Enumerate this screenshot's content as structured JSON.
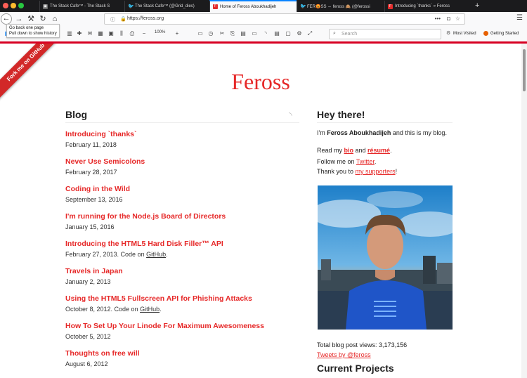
{
  "browser": {
    "tabs": [
      {
        "title": "The Stack Cafe™ - The Stack S",
        "icon": "stack-cafe-favicon"
      },
      {
        "title": "The Stack Cafe™ (@Grid_dies)",
        "icon": "twitter-icon"
      },
      {
        "title": "Home of Feross Aboukhadijeh",
        "icon": "feross-favicon",
        "active": true
      },
      {
        "title": "FER😡SS ⇔ feross 🙈 (@ferossi",
        "icon": "twitter-icon"
      },
      {
        "title": "Introducing `thanks` » Feross",
        "icon": "feross-favicon"
      }
    ],
    "new_tab_label": "+",
    "url": "https://feross.org",
    "tooltip_line1": "Go back one page",
    "tooltip_line2": "Pull down to show history",
    "zoom": "100%",
    "search_placeholder": "Search",
    "bookmarks": [
      "Most Visited",
      "Getting Started"
    ],
    "accent_color": "#d70022"
  },
  "page": {
    "ribbon": "Fork me on GitHub",
    "site_title": "Feross",
    "blog_heading": "Blog",
    "posts": [
      {
        "title": "Introducing `thanks`",
        "date": "February 11, 2018"
      },
      {
        "title": "Never Use Semicolons",
        "date": "February 28, 2017"
      },
      {
        "title": "Coding in the Wild",
        "date": "September 13, 2016"
      },
      {
        "title": "I'm running for the Node.js Board of Directors",
        "date": "January 15, 2016"
      },
      {
        "title": "Introducing the HTML5 Hard Disk Filler™ API",
        "date": "February 27, 2013. Code on ",
        "link": "GitHub",
        "suffix": "."
      },
      {
        "title": "Travels in Japan",
        "date": "January 2, 2013"
      },
      {
        "title": "Using the HTML5 Fullscreen API for Phishing Attacks",
        "date": "October 8, 2012. Code on ",
        "link": "GitHub",
        "suffix": "."
      },
      {
        "title": "How To Set Up Your Linode For Maximum Awesomeness",
        "date": "October 5, 2012"
      },
      {
        "title": "Thoughts on free will",
        "date": "August 6, 2012"
      }
    ],
    "sidebar": {
      "heading": "Hey there!",
      "intro_pre": "I'm ",
      "intro_name": "Feross Aboukhadijeh",
      "intro_post": " and this is my blog.",
      "read_pre": "Read my ",
      "bio": "bio",
      "and": " and ",
      "resume": "résumé",
      "read_post": ".",
      "follow_pre": "Follow me on ",
      "twitter": "Twitter",
      "follow_post": ".",
      "thank_pre": "Thank you to ",
      "supporters": "my supporters",
      "thank_post": "!",
      "views_label": "Total blog post views: ",
      "views_count": "3,173,156",
      "tweets_link": "Tweets by @feross",
      "current_projects": "Current Projects"
    },
    "link_color": "#e62828"
  }
}
